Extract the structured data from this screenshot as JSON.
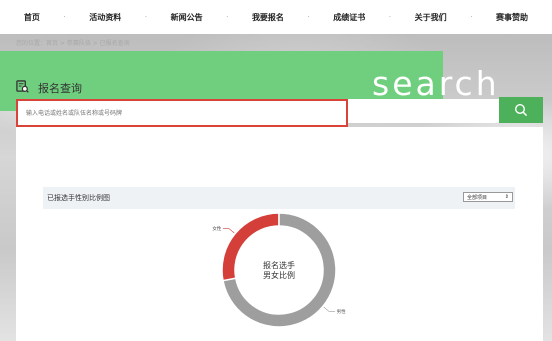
{
  "nav": {
    "items": [
      {
        "label": "首页"
      },
      {
        "label": "活动资料"
      },
      {
        "label": "新闻公告"
      },
      {
        "label": "我要报名"
      },
      {
        "label": "成绩证书"
      },
      {
        "label": "关于我们"
      },
      {
        "label": "赛事赞助"
      }
    ],
    "separator": "·"
  },
  "breadcrumb": "您的位置：首页 > 参赛队伍 > 已报名查询",
  "banner": {
    "word": "search"
  },
  "page_title": "报名查询",
  "search": {
    "placeholder": "输入电话或姓名或队伍名称或号码牌"
  },
  "chart_panel": {
    "title": "已报选手性别比例图",
    "select_value": "全部项目"
  },
  "colors": {
    "accent_green": "#6fcf7e",
    "button_green": "#4db05a",
    "female_red": "#d43f3a",
    "male_gray": "#9e9e9e"
  },
  "chart_data": {
    "type": "pie",
    "title": "报名选手男女比例",
    "center_label_lines": [
      "报名选手",
      "男女比例"
    ],
    "categories": [
      "女性",
      "男性"
    ],
    "values": [
      28,
      72
    ],
    "colors": [
      "#d43f3a",
      "#9e9e9e"
    ]
  }
}
